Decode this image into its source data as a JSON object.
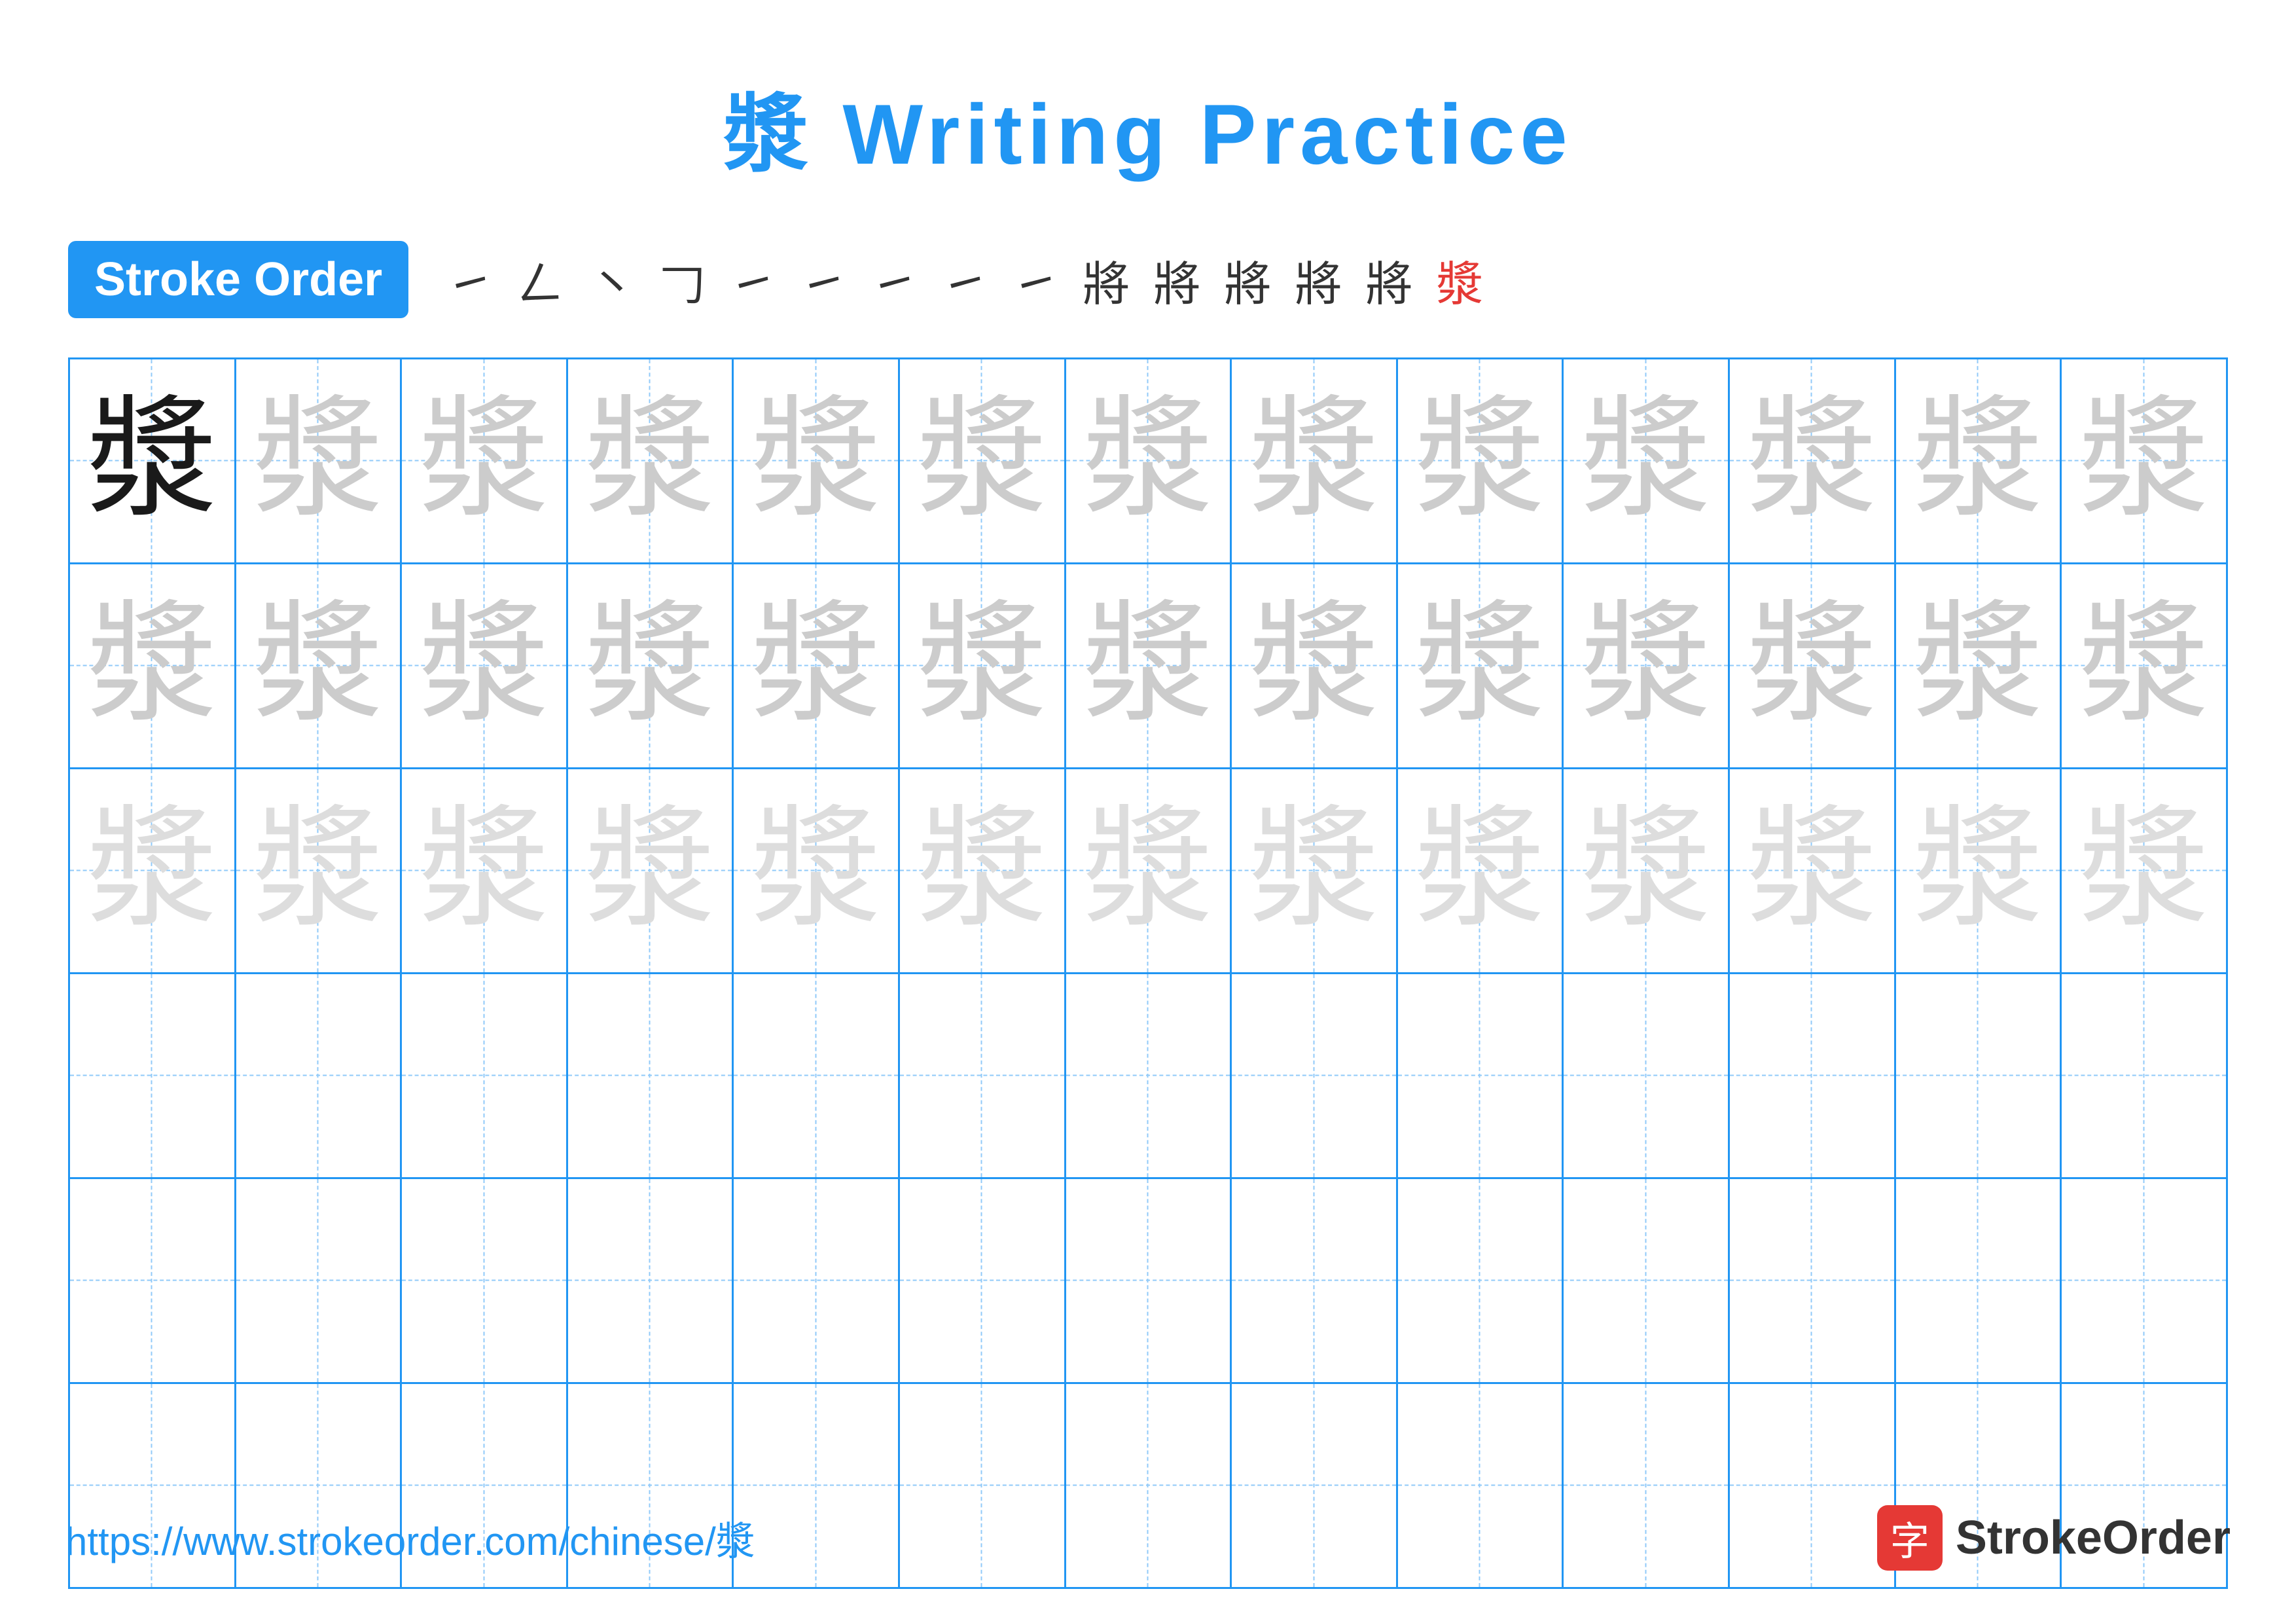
{
  "title": "漿 Writing Practice",
  "stroke_order_label": "Stroke Order",
  "stroke_steps": [
    "㇀",
    "𠃋",
    "㇔",
    "𠃌",
    "㇀",
    "㇀",
    "㇀",
    "㇀",
    "㇀",
    "將",
    "將",
    "將",
    "將",
    "將",
    "漿"
  ],
  "character": "漿",
  "rows": [
    {
      "type": "dark_then_light1",
      "count": 13
    },
    {
      "type": "light1",
      "count": 13
    },
    {
      "type": "light2",
      "count": 13
    },
    {
      "type": "empty",
      "count": 13
    },
    {
      "type": "empty",
      "count": 13
    },
    {
      "type": "empty",
      "count": 13
    }
  ],
  "footer": {
    "url": "https://www.strokeorder.com/chinese/漿",
    "logo_text": "StrokeOrder",
    "logo_icon": "字"
  }
}
